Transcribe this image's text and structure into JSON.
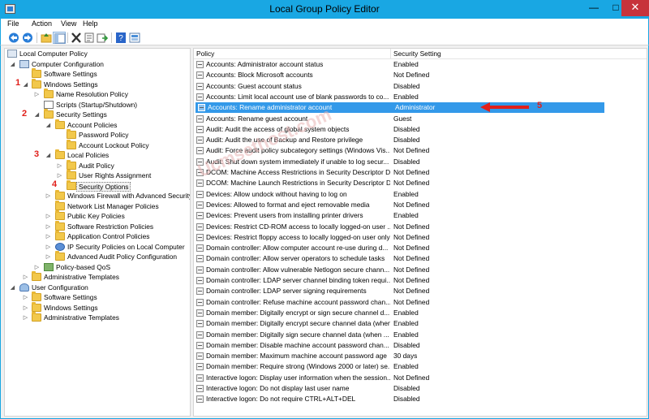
{
  "window": {
    "title": "Local Group Policy Editor",
    "minimize": "—",
    "maximize": "□",
    "close": "✕"
  },
  "menu": [
    "File",
    "Action",
    "View",
    "Help"
  ],
  "toolbar": [
    "back-icon",
    "forward-icon",
    "up-folder-icon",
    "show-hide-tree-icon",
    "delete-icon",
    "properties-icon",
    "export-icon",
    "help-icon",
    "view-icon"
  ],
  "tree": [
    {
      "label": "Local Computer Policy",
      "icon": "computer-policy-icon"
    },
    {
      "label": "Computer Configuration",
      "icon": "computer-icon"
    },
    {
      "label": "Software Settings"
    },
    {
      "label": "Windows Settings"
    },
    {
      "label": "Name Resolution Policy"
    },
    {
      "label": "Scripts (Startup/Shutdown)"
    },
    {
      "label": "Security Settings"
    },
    {
      "label": "Account Policies"
    },
    {
      "label": "Password Policy"
    },
    {
      "label": "Account Lockout Policy"
    },
    {
      "label": "Local Policies"
    },
    {
      "label": "Audit Policy"
    },
    {
      "label": "User Rights Assignment"
    },
    {
      "label": "Security Options"
    },
    {
      "label": "Windows Firewall with Advanced Security"
    },
    {
      "label": "Network List Manager Policies"
    },
    {
      "label": "Public Key Policies"
    },
    {
      "label": "Software Restriction Policies"
    },
    {
      "label": "Application Control Policies"
    },
    {
      "label": "IP Security Policies on Local Computer"
    },
    {
      "label": "Advanced Audit Policy Configuration"
    },
    {
      "label": "Policy-based QoS"
    },
    {
      "label": "Administrative Templates"
    },
    {
      "label": "User Configuration",
      "icon": "user-icon"
    },
    {
      "label": "Software Settings"
    },
    {
      "label": "Windows Settings"
    },
    {
      "label": "Administrative Templates"
    }
  ],
  "markers": [
    "1",
    "2",
    "3",
    "4",
    "5"
  ],
  "list": {
    "col_policy": "Policy",
    "col_setting": "Security Setting",
    "selected_index": 4,
    "rows": [
      [
        "Accounts: Administrator account status",
        "Enabled"
      ],
      [
        "Accounts: Block Microsoft accounts",
        "Not Defined"
      ],
      [
        "Accounts: Guest account status",
        "Disabled"
      ],
      [
        "Accounts: Limit local account use of blank passwords to co...",
        "Enabled"
      ],
      [
        "Accounts: Rename administrator account",
        "Administrator"
      ],
      [
        "Accounts: Rename guest account",
        "Guest"
      ],
      [
        "Audit: Audit the access of global system objects",
        "Disabled"
      ],
      [
        "Audit: Audit the use of Backup and Restore privilege",
        "Disabled"
      ],
      [
        "Audit: Force audit policy subcategory settings (Windows Vis...",
        "Not Defined"
      ],
      [
        "Audit: Shut down system immediately if unable to log secur...",
        "Disabled"
      ],
      [
        "DCOM: Machine Access Restrictions in Security Descriptor D...",
        "Not Defined"
      ],
      [
        "DCOM: Machine Launch Restrictions in Security Descriptor D...",
        "Not Defined"
      ],
      [
        "Devices: Allow undock without having to log on",
        "Enabled"
      ],
      [
        "Devices: Allowed to format and eject removable media",
        "Not Defined"
      ],
      [
        "Devices: Prevent users from installing printer drivers",
        "Enabled"
      ],
      [
        "Devices: Restrict CD-ROM access to locally logged-on user ...",
        "Not Defined"
      ],
      [
        "Devices: Restrict floppy access to locally logged-on user only",
        "Not Defined"
      ],
      [
        "Domain controller: Allow computer account re-use during d...",
        "Not Defined"
      ],
      [
        "Domain controller: Allow server operators to schedule tasks",
        "Not Defined"
      ],
      [
        "Domain controller: Allow vulnerable Netlogon secure chann...",
        "Not Defined"
      ],
      [
        "Domain controller: LDAP server channel binding token requi...",
        "Not Defined"
      ],
      [
        "Domain controller: LDAP server signing requirements",
        "Not Defined"
      ],
      [
        "Domain controller: Refuse machine account password chan...",
        "Not Defined"
      ],
      [
        "Domain member: Digitally encrypt or sign secure channel d...",
        "Enabled"
      ],
      [
        "Domain member: Digitally encrypt secure channel data (when...",
        "Enabled"
      ],
      [
        "Domain member: Digitally sign secure channel data (when ...",
        "Enabled"
      ],
      [
        "Domain member: Disable machine account password chan...",
        "Disabled"
      ],
      [
        "Domain member: Maximum machine account password age",
        "30 days"
      ],
      [
        "Domain member: Require strong (Windows 2000 or later) se...",
        "Enabled"
      ],
      [
        "Interactive logon: Display user information when the session...",
        "Not Defined"
      ],
      [
        "Interactive logon: Do not display last user name",
        "Disabled"
      ],
      [
        "Interactive logon: Do not require CTRL+ALT+DEL",
        "Disabled"
      ]
    ]
  },
  "watermark": "Ucmsethost.com"
}
